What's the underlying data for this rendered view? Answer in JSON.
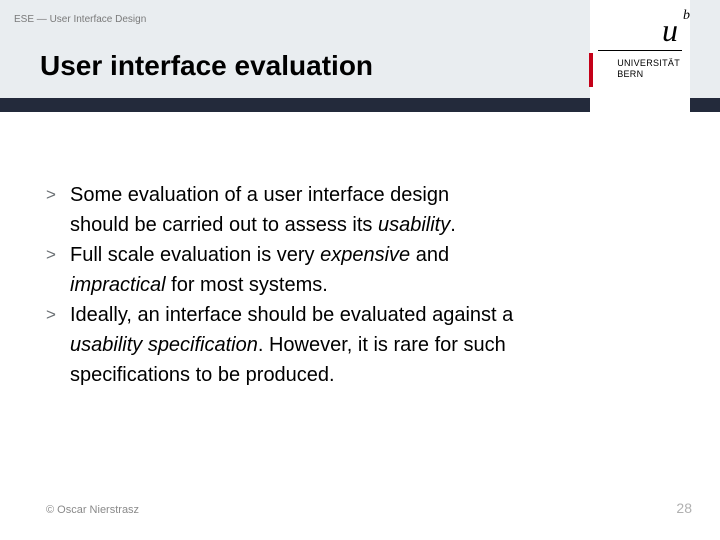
{
  "header": {
    "breadcrumb": "ESE — User Interface Design",
    "title": "User interface evaluation"
  },
  "logo": {
    "u": "u",
    "b": "b",
    "uni1": "UNIVERSITÄT",
    "uni2": "BERN"
  },
  "bullets": {
    "marker": ">",
    "b1l1a": "Some evaluation of a user interface design",
    "b1l2a": "should be carried out to assess its ",
    "b1l2b": "usability",
    "b1l2c": ".",
    "b2l1a": "Full scale evaluation is very ",
    "b2l1b": "expensive",
    "b2l1c": " and",
    "b2l2a": "impractical",
    "b2l2b": " for most systems.",
    "b3l1a": "Ideally, an interface should be evaluated against a",
    "b3l2a": "usability specification",
    "b3l2b": ". However, it is rare for such",
    "b3l3a": "specifications to be produced."
  },
  "footer": {
    "left": "© Oscar Nierstrasz",
    "right": "28"
  }
}
